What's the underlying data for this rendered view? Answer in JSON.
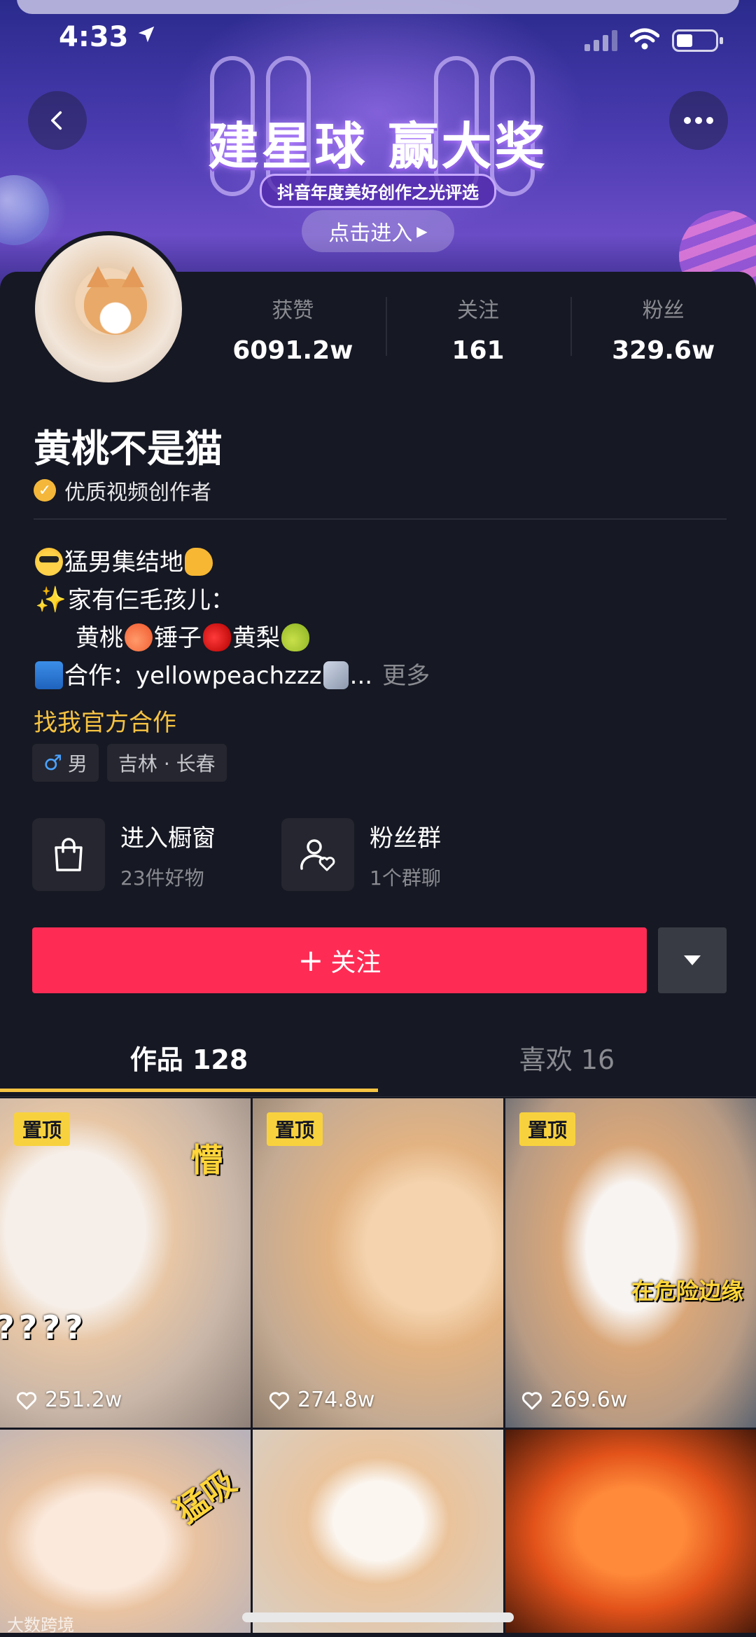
{
  "status_bar": {
    "time": "4:33"
  },
  "banner": {
    "title": "建星球 赢大奖",
    "subtitle": "抖音年度美好创作之光评选",
    "enter_label": "点击进入"
  },
  "profile": {
    "stats": [
      {
        "label": "获赞",
        "value": "6091.2w"
      },
      {
        "label": "关注",
        "value": "161"
      },
      {
        "label": "粉丝",
        "value": "329.6w"
      }
    ],
    "name": "黄桃不是猫",
    "verification": "优质视频创作者",
    "bio": {
      "line1": "猛男集结地",
      "line2": "家有仨毛孩儿：",
      "line3_a": "黄桃",
      "line3_b": "锤子",
      "line3_c": "黄梨",
      "line4": "合作：yellowpeachzzz",
      "line4_ellipsis": "...",
      "more": "更多"
    },
    "official_link": "找我官方合作",
    "tags": {
      "gender": "男",
      "location": "吉林 · 长春"
    }
  },
  "cards": [
    {
      "title": "进入橱窗",
      "subtitle": "23件好物"
    },
    {
      "title": "粉丝群",
      "subtitle": "1个群聊"
    }
  ],
  "follow_button": "关注",
  "tabs": [
    {
      "label": "作品 128"
    },
    {
      "label": "喜欢 16"
    }
  ],
  "videos": [
    {
      "pinned": "置顶",
      "likes": "251.2w",
      "caption": "懵",
      "caption2": "????"
    },
    {
      "pinned": "置顶",
      "likes": "274.8w"
    },
    {
      "pinned": "置顶",
      "likes": "269.6w",
      "caption": "在危险边缘"
    },
    {
      "caption": "猛吸"
    },
    {},
    {}
  ],
  "watermark": "大数跨境",
  "colors": {
    "follow": "#fe2c55",
    "accent": "#f6c342",
    "background": "#161823"
  }
}
